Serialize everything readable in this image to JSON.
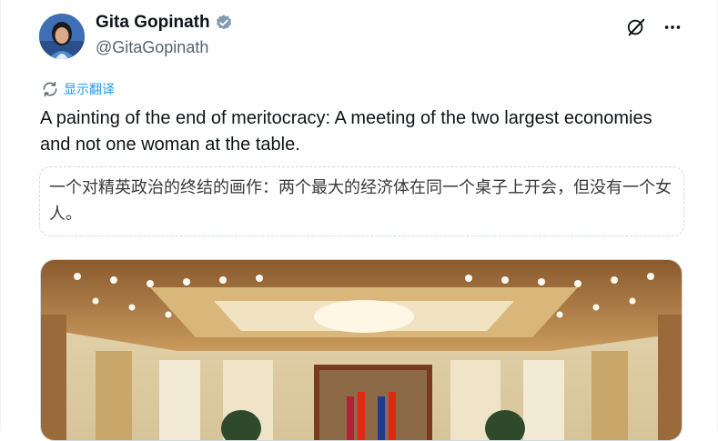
{
  "header": {
    "display_name": "Gita Gopinath",
    "handle": "@GitaGopinath",
    "verified": true,
    "icons": [
      "grok-icon",
      "more-icon"
    ]
  },
  "translate": {
    "label": "显示翻译",
    "icon": "translate-icon"
  },
  "tweet": {
    "text": "A painting of the end of meritocracy: A meeting of the two largest economies and not one woman at the table."
  },
  "translation": {
    "text": "一个对精英政治的终结的画作：两个最大的经济体在同一个桌子上开会，但没有一个女人。"
  },
  "media": {
    "description_icon": "photo"
  },
  "colors": {
    "accent": "#1d9bf0",
    "secondary_text": "#536471",
    "primary_text": "#0f1419",
    "border": "#cfd9de"
  }
}
